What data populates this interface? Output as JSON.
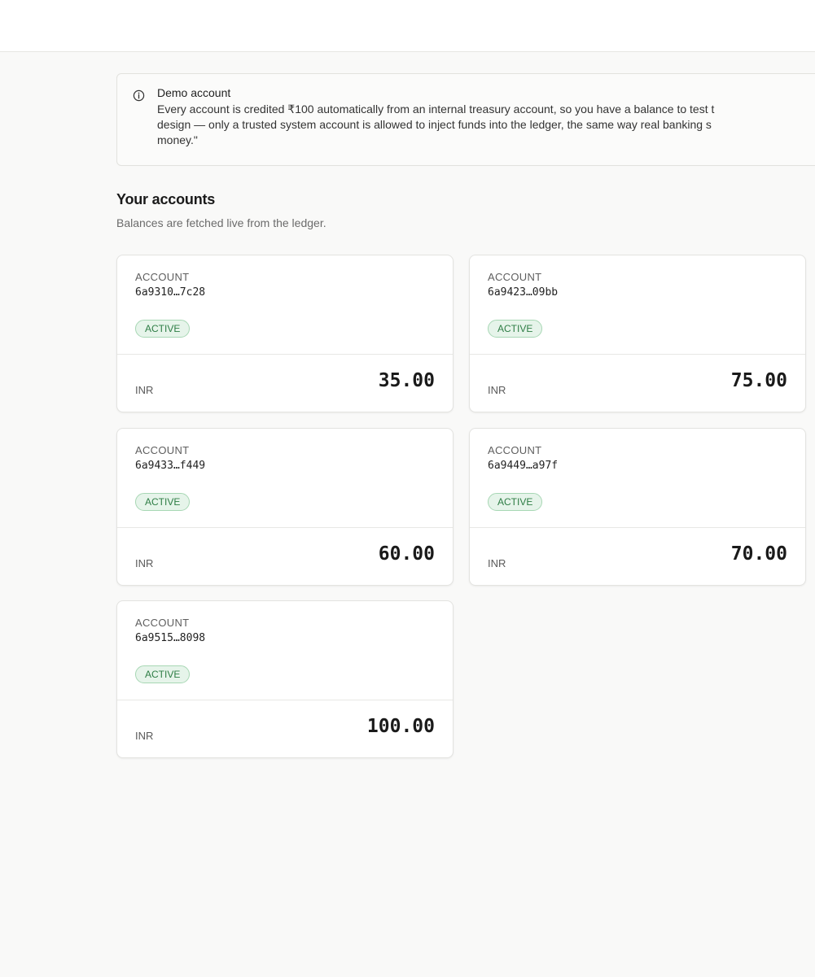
{
  "notice": {
    "icon": "info-icon",
    "title": "Demo account",
    "lines": [
      "Every account is credited ₹100 automatically from an internal treasury account, so you have a balance to test t",
      "design — only a trusted system account is allowed to inject funds into the ledger, the same way real banking s",
      "money.\""
    ]
  },
  "accounts_section": {
    "title": "Your accounts",
    "subtitle": "Balances are fetched live from the ledger."
  },
  "accounts": [
    {
      "label": "ACCOUNT",
      "id": "6a9310…7c28",
      "status": "ACTIVE",
      "currency": "INR",
      "balance": "35.00"
    },
    {
      "label": "ACCOUNT",
      "id": "6a9423…09bb",
      "status": "ACTIVE",
      "currency": "INR",
      "balance": "75.00"
    },
    {
      "label": "ACCOUNT",
      "id": "6a9433…f449",
      "status": "ACTIVE",
      "currency": "INR",
      "balance": "60.00"
    },
    {
      "label": "ACCOUNT",
      "id": "6a9449…a97f",
      "status": "ACTIVE",
      "currency": "INR",
      "balance": "70.00"
    },
    {
      "label": "ACCOUNT",
      "id": "6a9515…8098",
      "status": "ACTIVE",
      "currency": "INR",
      "balance": "100.00"
    }
  ],
  "colors": {
    "status_active_bg": "#e6f4ea",
    "status_active_text": "#2e7d45",
    "page_bg": "#f9f9f8"
  }
}
